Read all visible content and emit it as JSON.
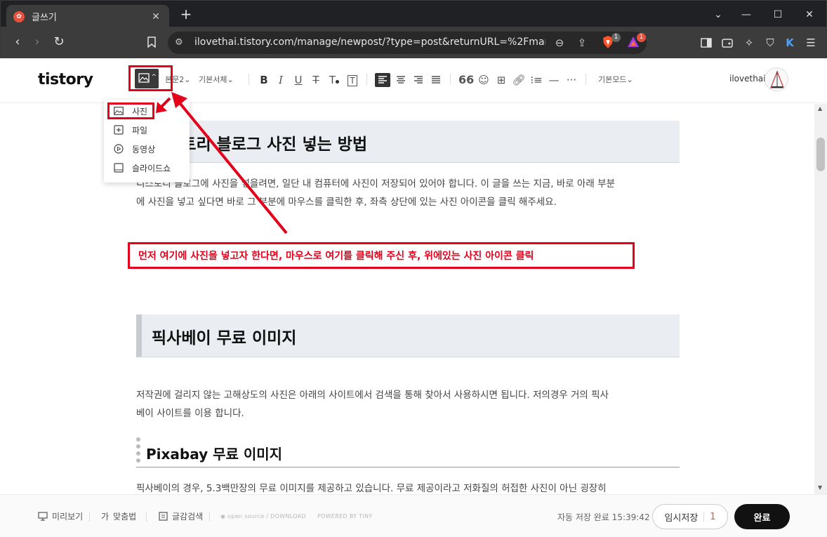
{
  "browser": {
    "tab_title": "글쓰기",
    "tab_favicon": "tistory-favicon",
    "url": "ilovethai.tistory.com/manage/newpost/?type=post&returnURL=%2Fmanage...",
    "brave_badge": "1",
    "rewards_badge": "1"
  },
  "editor": {
    "logo": "tistory",
    "toolbar": {
      "heading_style": "본문2",
      "font_face": "기본서체",
      "mode": "기본모드"
    },
    "user_name": "ilovethai"
  },
  "attach_menu": {
    "items": [
      {
        "label": "사진",
        "icon": "image-icon"
      },
      {
        "label": "파일",
        "icon": "file-plus-icon"
      },
      {
        "label": "동영상",
        "icon": "play-circle-icon"
      },
      {
        "label": "슬라이드쇼",
        "icon": "slideshow-icon"
      }
    ]
  },
  "content": {
    "heading1": "티스토리 블로그 사진 넣는 방법",
    "para1_line1": "티스토리 블로그에 사진을 넣을려면, 일단 내 컴퓨터에 사진이 저장되어 있어야 합니다. 이 글을 쓰는 지금, 바로 아래 부분",
    "para1_line2": "에 사진을 넣고 싶다면 바로 그 부분에 마우스를 클릭한 후, 좌측 상단에 있는 사진 아이콘을 클릭 해주세요.",
    "red_note": "먼저 여기에 사진을 넣고자 한다면, 마우스로 여기를 클릭해 주신 후, 위에있는 사진 아이콘 클릭",
    "heading2": "픽사베이 무료 이미지",
    "para2_line1": "저작권에 걸리지 않는 고해상도의 사진은 아래의 사이트에서 검색을 통해 찾아서 사용하시면 됩니다. 저의경우 거의 픽사",
    "para2_line2": "베이 사이트를 이용 합니다.",
    "heading3": "Pixabay 무료 이미지",
    "para3_line1": "픽사베이의 경우, 5.3백만장의 무료 이미지를 제공하고 있습니다. 무료 제공이라고 저화질의 허접한 사진이 아닌 굉장히"
  },
  "footer": {
    "preview": "미리보기",
    "spellcheck": "맞춤법",
    "quote_search": "글감검색",
    "opensource": "open source / DOWNLOAD",
    "powered": "POWERED BY TINY",
    "autosave": "자동 저장 완료 15:39:42",
    "draft": "임시저장",
    "draft_count": "1",
    "done": "완료"
  },
  "colors": {
    "annotation_red": "#e2001a",
    "heading_bg": "#eaeef2",
    "done_button": "#111111",
    "draft_count": "#e8503e"
  }
}
